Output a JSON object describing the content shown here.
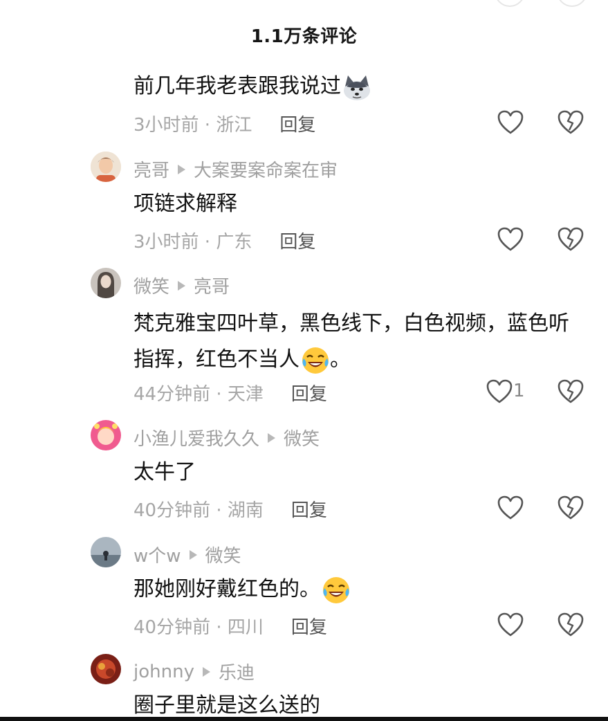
{
  "header": {
    "title": "1.1万条评论"
  },
  "comments": [
    {
      "username": "",
      "reply_to": "",
      "text": "前几年我老表跟我说过",
      "emoji": "husky-emoji",
      "time_location": "3小时前 · 浙江",
      "reply_label": "回复",
      "likes": ""
    },
    {
      "username": "亮哥",
      "reply_to": "大案要案命案在审",
      "text": "项链求解释",
      "emoji": "",
      "time_location": "3小时前 · 广东",
      "reply_label": "回复",
      "likes": ""
    },
    {
      "username": "微笑",
      "reply_to": "亮哥",
      "text": "梵克雅宝四叶草，黑色线下，白色视频，蓝色听指挥，红色不当人",
      "text_tail": "。",
      "emoji": "laugh-cry-emoji",
      "time_location": "44分钟前 · 天津",
      "reply_label": "回复",
      "likes": "1"
    },
    {
      "username": "小渔儿爱我久久",
      "reply_to": "微笑",
      "text": "太牛了",
      "emoji": "",
      "time_location": "40分钟前 · 湖南",
      "reply_label": "回复",
      "likes": ""
    },
    {
      "username": "w个w",
      "reply_to": "微笑",
      "text": "那她刚好戴红色的。",
      "emoji": "laugh-cry-emoji",
      "time_location": "40分钟前 · 四川",
      "reply_label": "回复",
      "likes": ""
    },
    {
      "username": "johnny",
      "reply_to": "乐迪",
      "text": "圈子里就是这么送的",
      "emoji": "",
      "time_location": "",
      "reply_label": "",
      "likes": ""
    }
  ],
  "colors": {
    "meta": "#a0a0a0",
    "text": "#111111",
    "icon": "#555555"
  }
}
